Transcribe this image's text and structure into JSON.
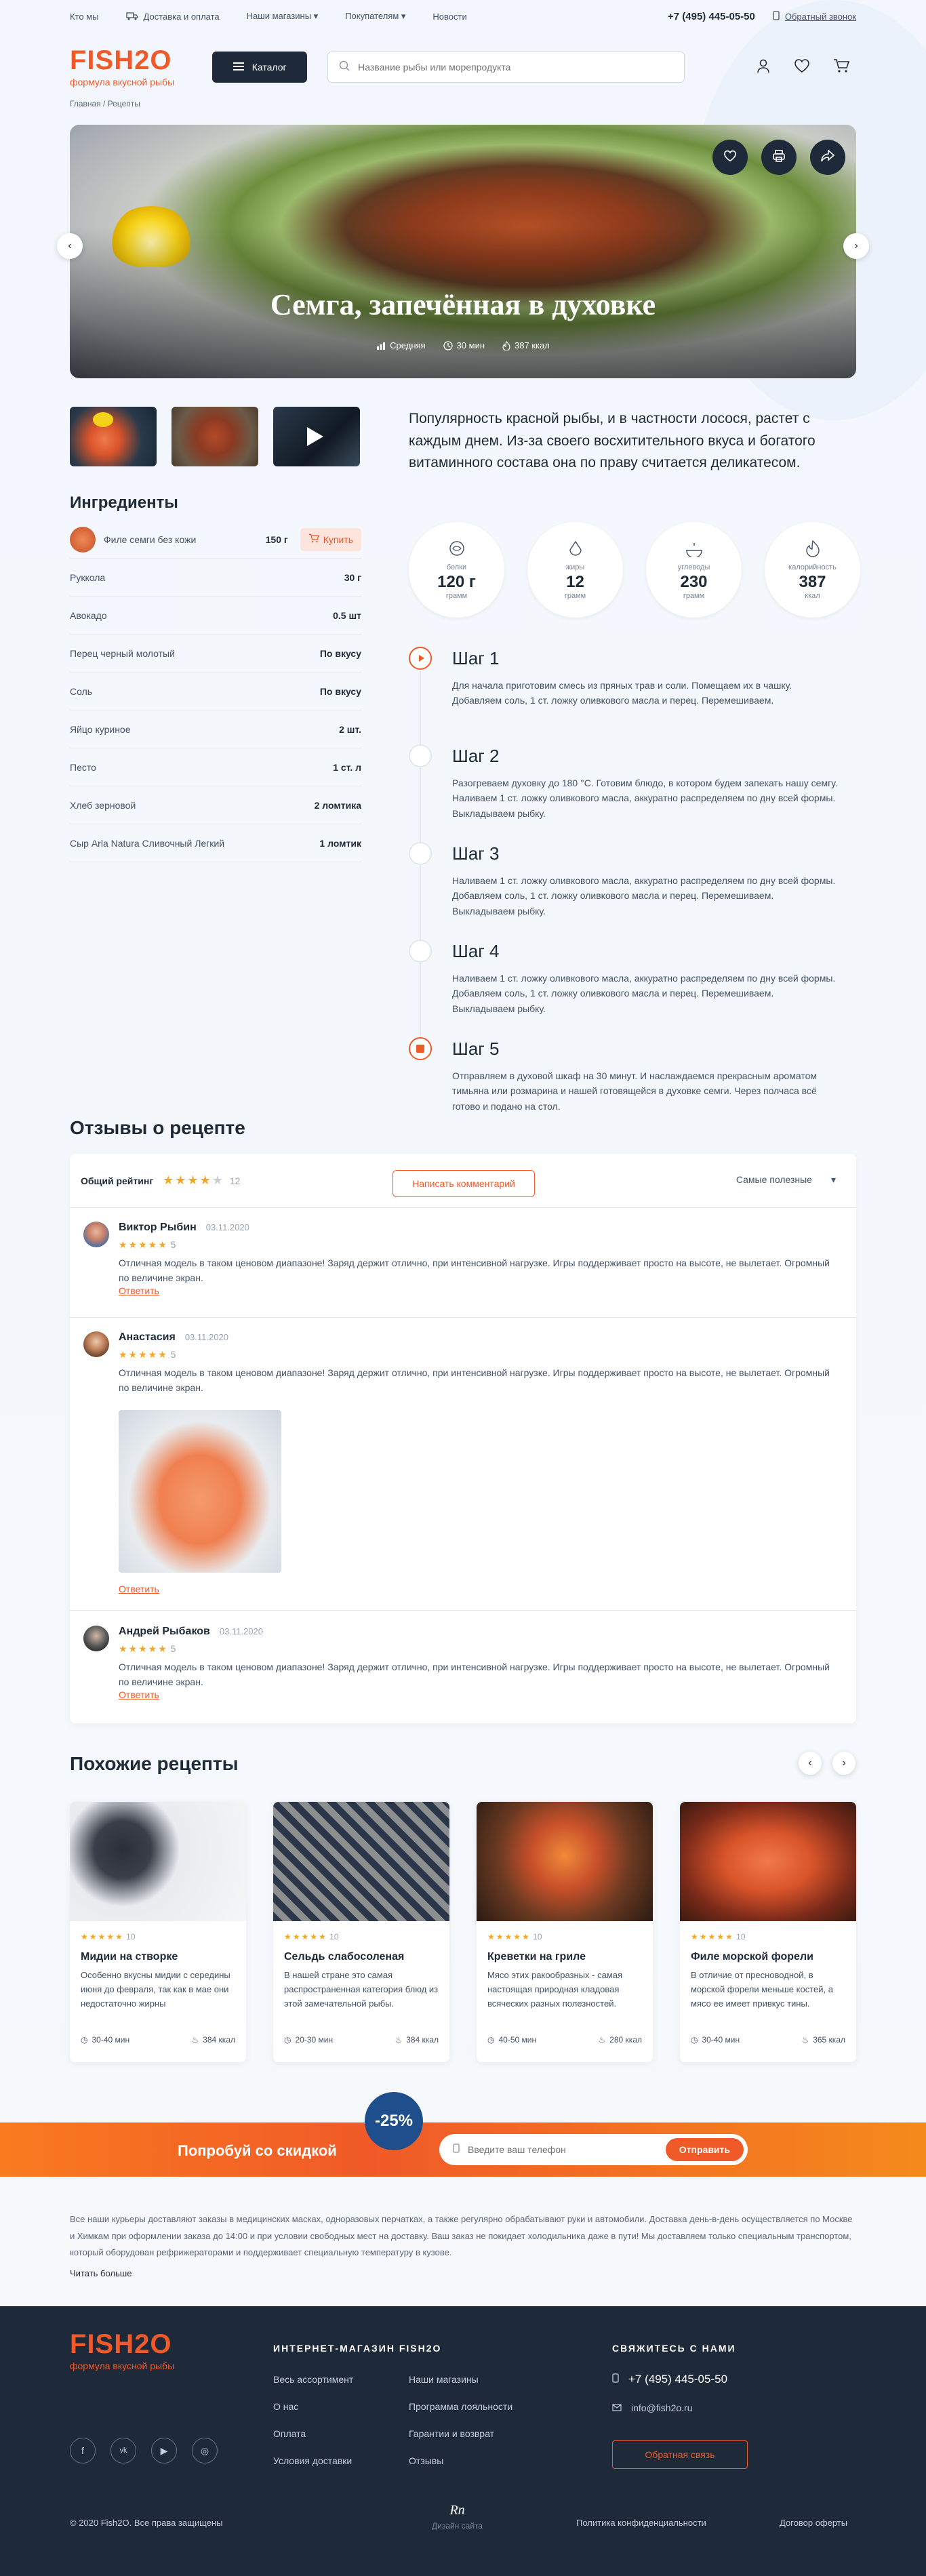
{
  "topbar": {
    "links": [
      "Кто мы",
      "Доставка и оплата",
      "Наши магазины",
      "Покупателям",
      "Новости"
    ],
    "phone": "+7 (495) 445-05-50",
    "callback": "Обратный звонок"
  },
  "header": {
    "logo": "FISH2O",
    "logo_sub": "формула вкусной рыбы",
    "catalog": "Каталог",
    "search_placeholder": "Название рыбы или морепродукта"
  },
  "breadcrumb": "Главная / Рецепты",
  "hero": {
    "title": "Семга, запечённая в духовке",
    "difficulty": "Средняя",
    "time": "30 мин",
    "kcal": "387 ккал"
  },
  "intro": "Популярность красной рыбы, и в частности лосося, растет с каждым днем. Из-за своего восхитительного вкуса и богатого витаминного состава она по праву считается деликатесом.",
  "ingredients": {
    "title": "Ингредиенты",
    "buy": "Купить",
    "items": [
      {
        "name": "Филе семги без кожи",
        "qty": "150 г"
      },
      {
        "name": "Руккола",
        "qty": "30 г"
      },
      {
        "name": "Авокадо",
        "qty": "0.5 шт"
      },
      {
        "name": "Перец черный молотый",
        "qty": "По вкусу"
      },
      {
        "name": "Соль",
        "qty": "По вкусу"
      },
      {
        "name": "Яйцо куриное",
        "qty": "2 шт."
      },
      {
        "name": "Песто",
        "qty": "1 ст. л"
      },
      {
        "name": "Хлеб зерновой",
        "qty": "2 ломтика"
      },
      {
        "name": "Сыр Arla Natura Сливочный Легкий",
        "qty": "1 ломтик"
      }
    ]
  },
  "nutrition": [
    {
      "label": "белки",
      "value": "120 г",
      "unit": "грамм"
    },
    {
      "label": "жиры",
      "value": "12",
      "unit": "грамм"
    },
    {
      "label": "углеводы",
      "value": "230",
      "unit": "грамм"
    },
    {
      "label": "калорийность",
      "value": "387",
      "unit": "ккал"
    }
  ],
  "steps": [
    {
      "title": "Шаг 1",
      "text": "Для начала приготовим смесь из пряных трав и соли. Помещаем их в чашку. Добавляем соль, 1 ст. ложку оливкового масла и перец. Перемешиваем."
    },
    {
      "title": "Шаг 2",
      "text": "Разогреваем духовку до 180 °С. Готовим блюдо, в котором будем запекать нашу семгу. Наливаем 1 ст. ложку оливкового масла, аккуратно распределяем по дну всей формы. Выкладываем рыбку."
    },
    {
      "title": "Шаг 3",
      "text": "Наливаем 1 ст. ложку оливкового масла, аккуратно распределяем по дну всей формы. Добавляем соль, 1 ст. ложку оливкового масла и перец. Перемешиваем. Выкладываем рыбку."
    },
    {
      "title": "Шаг 4",
      "text": "Наливаем 1 ст. ложку оливкового масла, аккуратно распределяем по дну всей формы. Добавляем соль, 1 ст. ложку оливкового масла и перец. Перемешиваем. Выкладываем рыбку."
    },
    {
      "title": "Шаг 5",
      "text": "Отправляем в духовой шкаф на 30 минут. И наслаждаемся прекрасным ароматом тимьяна или розмарина и нашей готовящейся в духовке семги. Через полчаса всё готово и подано на стол."
    }
  ],
  "reviews": {
    "title": "Отзывы о рецепте",
    "overall_label": "Общий рейтинг",
    "overall_count": "12",
    "write": "Написать комментарий",
    "sort": "Самые полезные",
    "reply": "Ответить",
    "items": [
      {
        "name": "Виктор Рыбин",
        "date": "03.11.2020",
        "rating": "5",
        "text": "Отличная модель в таком ценовом диапазоне! Заряд держит отлично, при интенсивной нагрузке. Игры поддерживает просто на высоте, не вылетает. Огромный по величине экран."
      },
      {
        "name": "Анастасия",
        "date": "03.11.2020",
        "rating": "5",
        "text": "Отличная модель в таком ценовом диапазоне! Заряд держит отлично, при интенсивной нагрузке. Игры поддерживает просто на высоте, не вылетает. Огромный по величине экран."
      },
      {
        "name": "Андрей Рыбаков",
        "date": "03.11.2020",
        "rating": "5",
        "text": "Отличная модель в таком ценовом диапазоне! Заряд держит отлично, при интенсивной нагрузке. Игры поддерживает просто на высоте, не вылетает. Огромный по величине экран."
      }
    ]
  },
  "similar": {
    "title": "Похожие рецепты",
    "items": [
      {
        "rating": "10",
        "title": "Мидии на створке",
        "text": "Особенно вкусны мидии с середины июня до февраля, так как в мае они недостаточно жирны",
        "time": "30-40 мин",
        "kcal": "384 ккал"
      },
      {
        "rating": "10",
        "title": "Сельдь слабосоленая",
        "text": "В нашей стране это самая распространенная категория блюд из этой замечательной рыбы.",
        "time": "20-30 мин",
        "kcal": "384 ккал"
      },
      {
        "rating": "10",
        "title": "Креветки на гриле",
        "text": "Мясо этих ракообразных - самая настоящая природная кладовая всяческих разных полезностей.",
        "time": "40-50 мин",
        "kcal": "280 ккал"
      },
      {
        "rating": "10",
        "title": "Филе морской форели",
        "text": "В отличие от пресноводной, в морской форели меньше костей, а мясо ее имеет привкус тины.",
        "time": "30-40 мин",
        "kcal": "365 ккал"
      }
    ]
  },
  "promo": {
    "text": "Попробуй со скидкой",
    "badge": "-25%",
    "placeholder": "Введите ваш телефон",
    "send": "Отправить"
  },
  "seo": {
    "text": "Все наши курьеры доставляют заказы в медицинских масках, одноразовых перчатках, а также регулярно обрабатывают руки и автомобили. Доставка день-в-день осуществляется по Москве и Химкам при оформлении заказа до 14:00 и при условии свободных мест на доставку. Ваш заказ не покидает холодильника даже в пути! Мы доставляем только специальным транспортом, который оборудован рефрижераторами и поддерживает специальную температуру в кузове.",
    "more": "Читать больше"
  },
  "footer": {
    "logo": "FISH2O",
    "logo_sub": "формула вкусной рыбы",
    "shop_title": "ИНТЕРНЕТ-МАГАЗИН FISH2O",
    "col1": [
      "Весь ассортимент",
      "О нас",
      "Оплата",
      "Условия доставки"
    ],
    "col2": [
      "Наши магазины",
      "Программа лояльности",
      "Гарантии и возврат",
      "Отзывы"
    ],
    "contact_title": "СВЯЖИТЕСЬ С НАМИ",
    "phone": "+7 (495) 445-05-50",
    "email": "info@fish2o.ru",
    "feedback": "Обратная связь",
    "copyright": "© 2020 Fish2O. Все права защищены",
    "design": "Дизайн сайта",
    "privacy": "Политика конфиденциальности",
    "offer": "Договор оферты"
  },
  "colors": {
    "accent": "#f05a28",
    "dark": "#1e2a3a",
    "star": "#f5a623"
  }
}
